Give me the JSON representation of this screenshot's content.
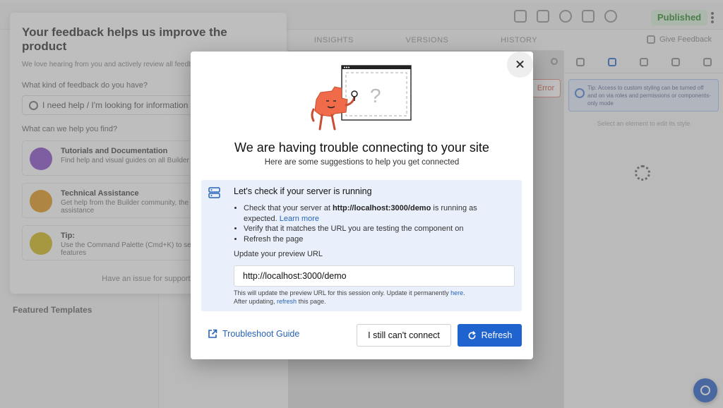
{
  "background": {
    "published_label": "Published",
    "tabs": [
      "INSIGHTS",
      "VERSIONS",
      "HISTORY"
    ],
    "give_feedback": "Give Feedback",
    "add_error": "Error",
    "feedback": {
      "title": "Your feedback helps us improve the product",
      "subtitle": "We love hearing from you and actively review all feedback received.",
      "question": "What kind of feedback do you have?",
      "input_value": "I need help / I'm looking for information",
      "question2": "What can we help you find?",
      "items": [
        {
          "title": "Tutorials and Documentation",
          "desc": "Find help and visual guides on all Builder features"
        },
        {
          "title": "Technical Assistance",
          "desc": "Get help from the Builder community, the best place to find technical assistance"
        },
        {
          "title": "Tip:",
          "desc": "Use the Command Palette (Cmd+K) to search through Builder's features"
        }
      ],
      "issue_text": "Have an issue for support?"
    },
    "featured_templates": "Featured Templates",
    "tip_text": "Tip: Access to custom styling can be turned off and on via roles and permissions or components-only mode",
    "right_hint": "Select an element to edit its style"
  },
  "modal": {
    "title": "We are having trouble connecting to your site",
    "subtitle": "Here are some suggestions to help you get connected",
    "check_title": "Let's check if your server is running",
    "bullet1_prefix": "Check that your server at ",
    "bullet1_url": "http://localhost:3000/demo",
    "bullet1_suffix": " is running as expected. ",
    "learn_more": "Learn more",
    "bullet2": "Verify that it matches the URL you are testing the component on",
    "bullet3": "Refresh the page",
    "url_label": "Update your preview URL",
    "url_value": "http://localhost:3000/demo",
    "note_line1": "This will update the preview URL for this session only. Update it permanently ",
    "note_here": "here",
    "note_after": "After updating, ",
    "note_refresh": "refresh",
    "note_end": " this page.",
    "troubleshoot": "Troubleshoot Guide",
    "cant_connect": "I still can't connect",
    "refresh": "Refresh"
  },
  "colors": {
    "primary": "#1f63cf",
    "link": "#2763b8",
    "info_bg": "#eaf0fb",
    "mascot": "#ef6b4a"
  }
}
